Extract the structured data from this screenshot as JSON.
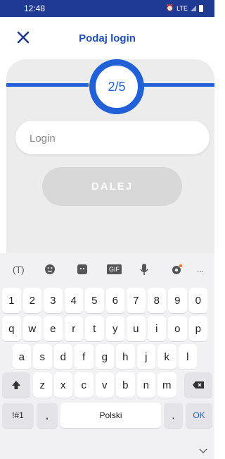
{
  "status_bar": {
    "time": "12:48",
    "network": "LTE"
  },
  "header": {
    "title": "Podaj login",
    "close_icon": "close-icon"
  },
  "progress": {
    "step_text": "2/5",
    "current": 2,
    "total": 5
  },
  "login": {
    "placeholder": "Login",
    "value": ""
  },
  "next_button": {
    "label": "DALEJ"
  },
  "keyboard": {
    "row1": [
      "1",
      "2",
      "3",
      "4",
      "5",
      "6",
      "7",
      "8",
      "9",
      "0"
    ],
    "row2": [
      "q",
      "w",
      "e",
      "r",
      "t",
      "y",
      "u",
      "i",
      "o",
      "p"
    ],
    "row3": [
      "a",
      "s",
      "d",
      "f",
      "g",
      "h",
      "j",
      "k",
      "l"
    ],
    "row4": [
      "z",
      "x",
      "c",
      "v",
      "b",
      "n",
      "m"
    ],
    "sym": "!#1",
    "comma": ",",
    "space": "Polski",
    "period": ".",
    "ok": "OK",
    "gif": "GIF",
    "more": "..."
  }
}
